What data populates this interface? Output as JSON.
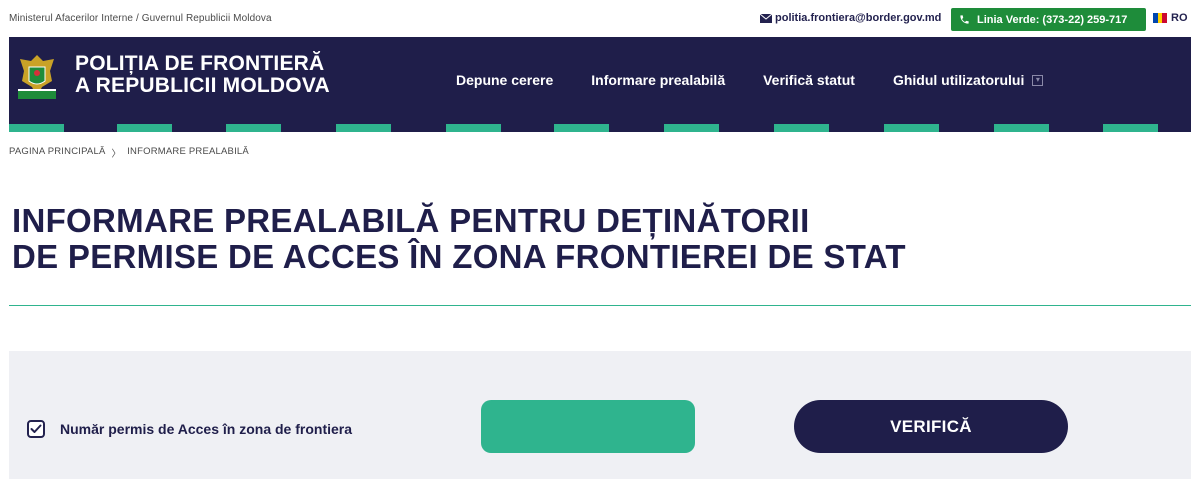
{
  "topbar": {
    "ministry": "Ministerul Afacerilor Interne / Guvernul Republicii Moldova",
    "email": "politia.frontiera@border.gov.md",
    "hotline": "Linia Verde: (373-22) 259-717",
    "language": "RO",
    "email_icon": "mail-icon",
    "phone_icon": "phone-icon"
  },
  "brand": {
    "line1": "POLIȚIA DE FRONTIERĂ",
    "line2": "A REPUBLICII MOLDOVA"
  },
  "nav": {
    "items": [
      {
        "label": "Depune cerere"
      },
      {
        "label": "Informare prealabilă"
      },
      {
        "label": "Verifică statut"
      },
      {
        "label": "Ghidul utilizatorului"
      }
    ]
  },
  "breadcrumb": {
    "home": "PAGINA PRINCIPALĂ",
    "separator": "〉",
    "current": "INFORMARE PREALABILĂ"
  },
  "page": {
    "title_line1": "INFORMARE PREALABILĂ PENTRU DEȚINĂTORII",
    "title_line2": "DE PERMISE DE ACCES ÎN ZONA FRONTIEREI DE STAT"
  },
  "form": {
    "checkbox_label": "Număr permis de Acces în zona de frontiera",
    "checkbox_checked": true,
    "permit_value": "",
    "verify_label": "VERIFICĂ"
  },
  "colors": {
    "navy": "#1f1e4a",
    "teal": "#2fb48e",
    "green": "#1e8c3a",
    "panel": "#eff0f4"
  }
}
